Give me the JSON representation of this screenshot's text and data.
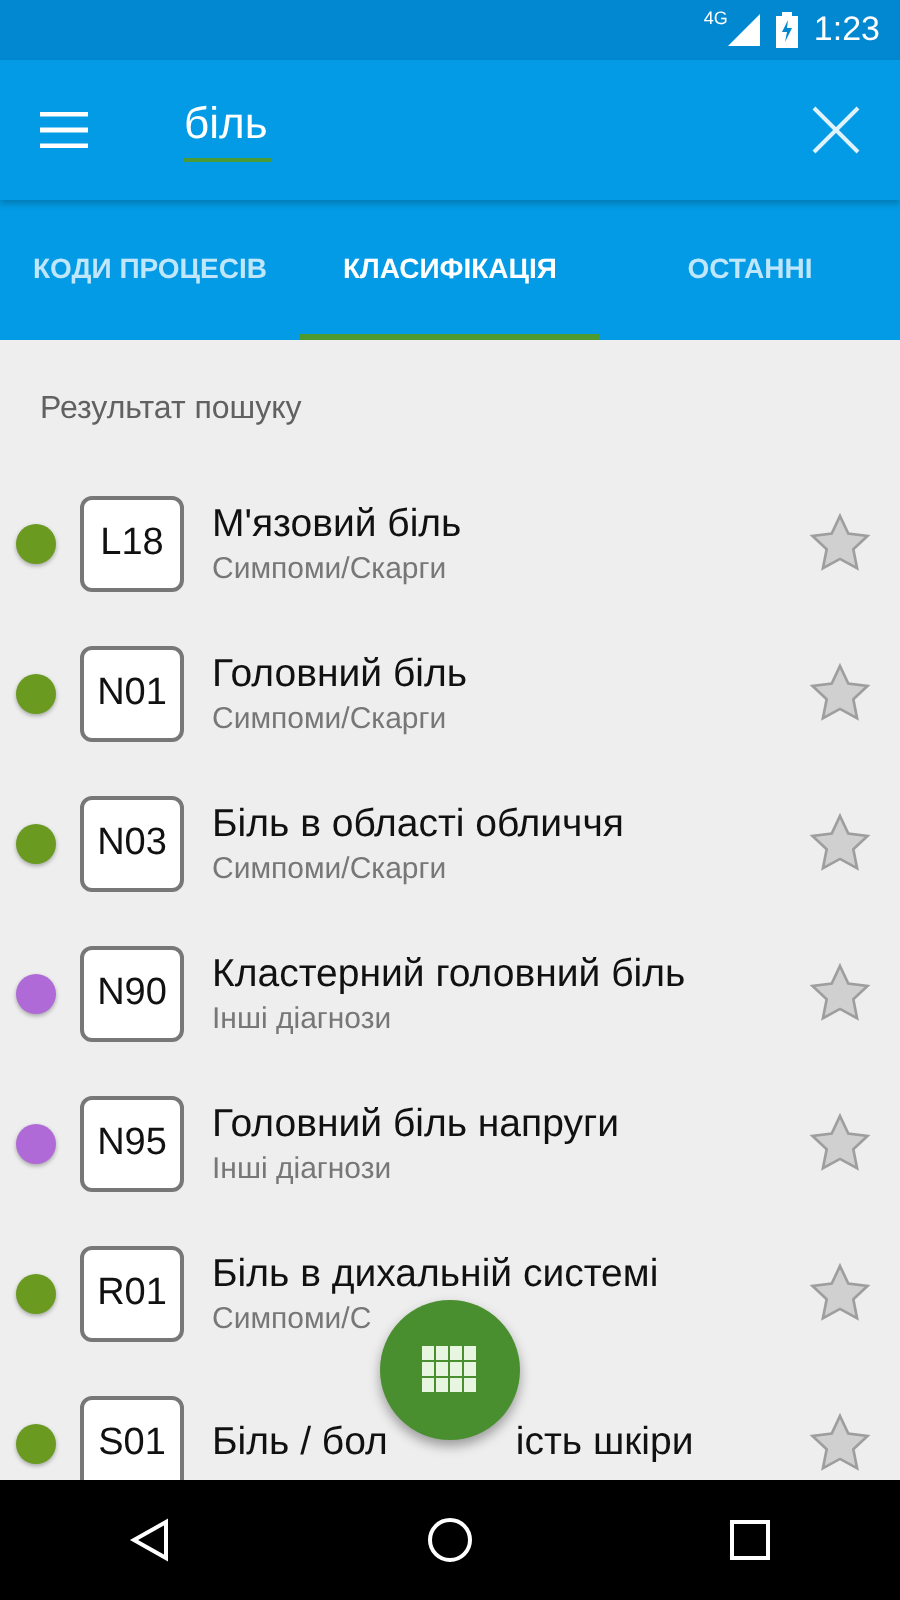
{
  "status_bar": {
    "network": "4G",
    "time": "1:23"
  },
  "toolbar": {
    "search": {
      "value": "біль"
    }
  },
  "tabs": [
    {
      "label": "КОДИ ПРОЦЕСІВ",
      "selected": false
    },
    {
      "label": "КЛАСИФІКАЦІЯ",
      "selected": true
    },
    {
      "label": "ОСТАННІ",
      "selected": false
    }
  ],
  "section_title": "Результат пошуку",
  "results": [
    {
      "code": "L18",
      "title": "М'язовий біль",
      "category": "Симпоми/Скарги",
      "color": "#6a9a1f",
      "favorite": false
    },
    {
      "code": "N01",
      "title": "Головний біль",
      "category": "Симпоми/Скарги",
      "color": "#6a9a1f",
      "favorite": false
    },
    {
      "code": "N03",
      "title": "Біль в області обличчя",
      "category": "Симпоми/Скарги",
      "color": "#6a9a1f",
      "favorite": false
    },
    {
      "code": "N90",
      "title": "Кластерний головний біль",
      "category": "Інші діагнози",
      "color": "#b06ad8",
      "favorite": false
    },
    {
      "code": "N95",
      "title": "Головний біль напруги",
      "category": "Інші діагнози",
      "color": "#b06ad8",
      "favorite": false
    },
    {
      "code": "R01",
      "title": "Біль в дихальній системі",
      "category": "Симпоми/С",
      "color": "#6a9a1f",
      "favorite": false
    },
    {
      "code": "S01",
      "title": "Біль / бол",
      "title_rest": "ість шкіри",
      "color": "#6a9a1f",
      "favorite": false
    }
  ]
}
